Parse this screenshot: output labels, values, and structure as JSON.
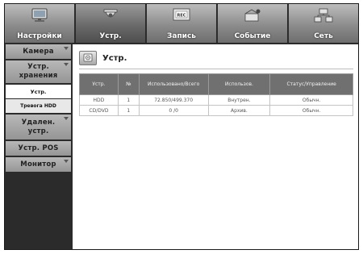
{
  "top_tabs": [
    {
      "label": "Настройки",
      "icon": "monitor-icon",
      "active": false
    },
    {
      "label": "Устр.",
      "icon": "camera-dome-icon",
      "active": true
    },
    {
      "label": "Запись",
      "icon": "rec-icon",
      "active": false
    },
    {
      "label": "Событие",
      "icon": "event-icon",
      "active": false
    },
    {
      "label": "Сеть",
      "icon": "network-icon",
      "active": false
    }
  ],
  "sidebar": {
    "camera": "Камера",
    "storage_line1": "Устр.",
    "storage_line2": "хранения",
    "sub_device": "Устр.",
    "sub_alarm": "Тревога HDD",
    "remote_line1": "Удален.",
    "remote_line2": "устр.",
    "pos": "Устр. POS",
    "monitor": "Монитор"
  },
  "main": {
    "title": "Устр.",
    "title_icon": "storage-icon",
    "table": {
      "headers": [
        "Устр.",
        "№",
        "Использовано/Всего",
        "Использов.",
        "Статус/Управление"
      ],
      "rows": [
        [
          "HDD",
          "1",
          "72.850/499.370",
          "Внутрен.",
          "Обычн."
        ],
        [
          "CD/DVD",
          "1",
          "0 /0",
          "Архив.",
          "Обычн."
        ]
      ]
    }
  }
}
